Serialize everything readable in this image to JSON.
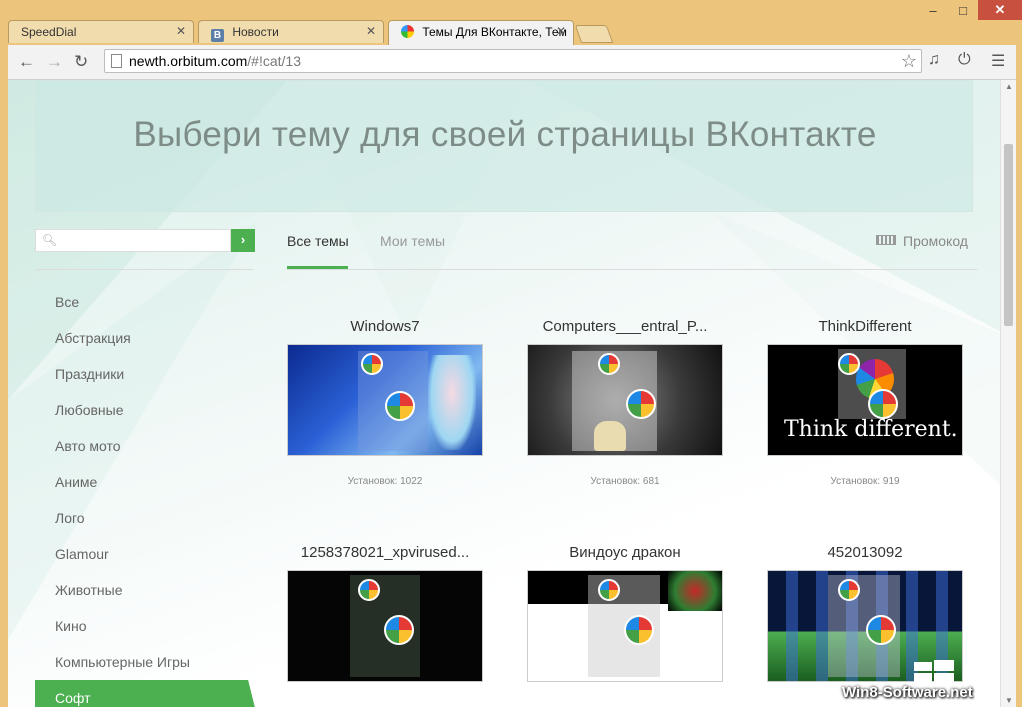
{
  "browser": {
    "tabs": [
      {
        "title": "SpeedDial",
        "favicon": "none",
        "active": false
      },
      {
        "title": "Новости",
        "favicon": "vk-icon",
        "active": false
      },
      {
        "title": "Темы Для ВКонтакте, Тем",
        "favicon": "orbitum-ball-icon",
        "active": true
      }
    ],
    "url_host": "newth.orbitum.com",
    "url_path": "/#!cat/13",
    "window_controls": {
      "minimize": "–",
      "maximize": "□",
      "close": "✕"
    },
    "vk_favicon_letter": "B"
  },
  "banner": {
    "title": "Выбери тему для своей страницы ВКонтакте"
  },
  "search": {
    "placeholder": "",
    "go_symbol": "›"
  },
  "sidebar": {
    "categories": [
      "Все",
      "Абстракция",
      "Праздники",
      "Любовные",
      "Авто мото",
      "Аниме",
      "Лого",
      "Glamour",
      "Животные",
      "Кино",
      "Компьютерные Игры",
      "Софт"
    ],
    "active_index": 11
  },
  "content_tabs": {
    "all": "Все темы",
    "mine": "Мои темы",
    "promo": "Промокод"
  },
  "themes": [
    {
      "name": "Windows7",
      "installs": "Установок: 1022"
    },
    {
      "name": "Computers___entral_P...",
      "installs": "Установок: 681"
    },
    {
      "name": "ThinkDifferent",
      "installs": "Установок: 919",
      "thumb_text": "Think different."
    },
    {
      "name": "1258378021_xpvirused...",
      "installs": ""
    },
    {
      "name": "Виндоус дракон",
      "installs": ""
    },
    {
      "name": "452013092",
      "installs": ""
    }
  ],
  "watermark": {
    "text": "Win8-Software.net"
  },
  "colors": {
    "accent_green": "#4caf50",
    "frame": "#ecc47c"
  }
}
